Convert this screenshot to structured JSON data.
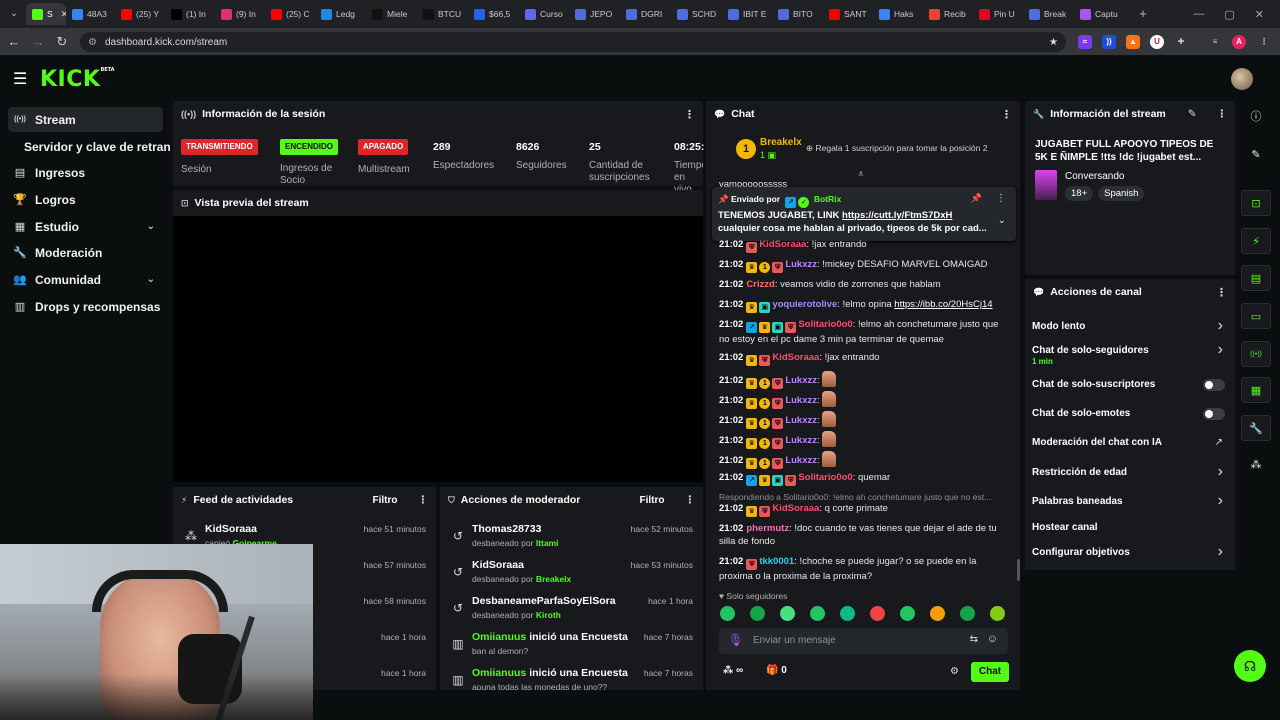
{
  "browser": {
    "tabs": [
      {
        "label": "S",
        "icon": "kick-favicon",
        "color": "#53fc18",
        "active": true
      },
      {
        "label": "48A3",
        "icon": "app-favicon",
        "color": "#3b82f6"
      },
      {
        "label": "(25) Y",
        "icon": "youtube-favicon",
        "color": "#ff0000"
      },
      {
        "label": "(1) In",
        "icon": "x-favicon",
        "color": "#000000"
      },
      {
        "label": "(9) In",
        "icon": "instagram-favicon",
        "color": "#e1306c"
      },
      {
        "label": "(25) C",
        "icon": "youtube-favicon",
        "color": "#ff0000"
      },
      {
        "label": "Ledg",
        "icon": "ledger-favicon",
        "color": "#1e88e5"
      },
      {
        "label": "Miele",
        "icon": "m-favicon",
        "color": "#111111"
      },
      {
        "label": "BTCU",
        "icon": "tv-favicon",
        "color": "#111111"
      },
      {
        "label": "$66,5",
        "icon": "x-favicon",
        "color": "#2563eb"
      },
      {
        "label": "Curso",
        "icon": "globe-favicon",
        "color": "#6366f1"
      },
      {
        "label": "JEPO",
        "icon": "sa-favicon",
        "color": "#4f6bdc"
      },
      {
        "label": "DGRI",
        "icon": "sa-favicon",
        "color": "#4f6bdc"
      },
      {
        "label": "SCHD",
        "icon": "sa-favicon",
        "color": "#4f6bdc"
      },
      {
        "label": "IBIT E",
        "icon": "sa-favicon",
        "color": "#4f6bdc"
      },
      {
        "label": "BITO",
        "icon": "sa-favicon",
        "color": "#4f6bdc"
      },
      {
        "label": "SANT",
        "icon": "santander-favicon",
        "color": "#ec0000"
      },
      {
        "label": "Haks",
        "icon": "doc-favicon",
        "color": "#3b82f6"
      },
      {
        "label": "Recib",
        "icon": "gmail-favicon",
        "color": "#ea4335"
      },
      {
        "label": "Pin U",
        "icon": "pinterest-favicon",
        "color": "#e60023"
      },
      {
        "label": "Break",
        "icon": "doc-favicon",
        "color": "#4f6bdc"
      },
      {
        "label": "Captu",
        "icon": "pen-favicon",
        "color": "#a855f7"
      }
    ],
    "new_tab": "+",
    "url": "dashboard.kick.com/stream",
    "profile_letter": "A"
  },
  "app": {
    "logo": "KICK",
    "logo_sup": "BETA"
  },
  "sidebar": {
    "items": [
      {
        "label": "Stream",
        "icon": "broadcast-icon"
      },
      {
        "label": "Servidor y clave de retransmisión",
        "icon": ""
      },
      {
        "label": "Ingresos",
        "icon": "chart-icon"
      },
      {
        "label": "Logros",
        "icon": "trophy-icon"
      },
      {
        "label": "Estudio",
        "icon": "grid-icon",
        "chevron": "⌄"
      },
      {
        "label": "Moderación",
        "icon": "wrench-icon"
      },
      {
        "label": "Comunidad",
        "icon": "users-icon",
        "chevron": "⌄"
      },
      {
        "label": "Drops y recompensas",
        "icon": "gift-icon"
      }
    ]
  },
  "session": {
    "title": "Información de la sesión",
    "badges": [
      {
        "text": "TRANSMITIENDO",
        "label": "Sesión",
        "bg": "#e0262b",
        "fg": "#ffffff"
      },
      {
        "text": "ENCENDIDO",
        "label": "Ingresos de Socio",
        "bg": "#53fc18",
        "fg": "#0b0e0f"
      },
      {
        "text": "APAGADO",
        "label": "Multistream",
        "bg": "#e0262b",
        "fg": "#ffffff"
      }
    ],
    "stats": [
      {
        "value": "289",
        "label": "Espectadores"
      },
      {
        "value": "8626",
        "label": "Seguidores"
      },
      {
        "value": "25",
        "label": "Cantidad de suscripciones"
      },
      {
        "value": "08:25:",
        "label": "Tiempo en vivo"
      }
    ]
  },
  "preview": {
    "title": "Vista previa del stream"
  },
  "activity": {
    "title": "Feed de actividades",
    "filter": "Filtro",
    "rows": [
      {
        "name": "KidSoraaa",
        "sub": "canjeó",
        "sub_bold": "Goipearme",
        "time": "hace 51 minutos"
      },
      {
        "name": "",
        "sub": "",
        "sub_bold": "",
        "time": "hace 57 minutos"
      },
      {
        "name": "",
        "sub": "",
        "sub_bold": "",
        "time": "hace 58 minutos"
      },
      {
        "name": "",
        "sub": "",
        "sub_bold": "",
        "time": "hace 1 hora"
      },
      {
        "name": "",
        "sub": "",
        "sub_bold": "",
        "time": "hace 1 hora"
      }
    ]
  },
  "modactions": {
    "title": "Acciones de moderador",
    "filter": "Filtro",
    "rows": [
      {
        "name": "Thomas28733",
        "rest": "",
        "sub": "desbaneado por",
        "by": "Ittami",
        "time": "hace 52 minutos",
        "icon": "undo-icon"
      },
      {
        "name": "KidSoraaa",
        "rest": "",
        "sub": "desbaneado por",
        "by": "Breakelx",
        "time": "hace 53 minutos",
        "icon": "undo-icon"
      },
      {
        "name": "DesbaneameParfaSoyElSora",
        "rest": "",
        "sub": "desbaneado por",
        "by": "Kiroth",
        "time": "hace 1 hora",
        "icon": "undo-icon"
      },
      {
        "name": "Omiianuus",
        "rest": "inició una Encuesta",
        "sub": "ban al demon?",
        "by": "",
        "time": "hace 7 horas",
        "icon": "poll-icon"
      },
      {
        "name": "Omiianuus",
        "rest": "inició una Encuesta",
        "sub": "apuna todas las monedas de uno??",
        "by": "",
        "time": "hace 7 horas",
        "icon": "poll-icon"
      }
    ]
  },
  "chat": {
    "title": "Chat",
    "top_gifter": {
      "name": "Breakelx",
      "count": "1"
    },
    "gift_prompt": "Regala 1 suscripción para tomar la posición 2",
    "partial": "vamooooosssss",
    "pinned": {
      "label": "Enviado por",
      "author": "BotRix",
      "line1": "TENEMOS JUGABET, LINK ",
      "link": "https://cutt.ly/FtmS7DxH",
      "line2": "cualquier cosa me hablan al privado, tipeos de 5k por cad..."
    },
    "messages": [
      {
        "time": "21:02",
        "user": "KidSoraaa",
        "color": "#ff4d6d",
        "text": ": !jax entrando",
        "badges": [
          "mod"
        ]
      },
      {
        "time": "21:02",
        "user": "Lukxzz",
        "color": "#c084fc",
        "text": ": !mickey DESAFIO MARVEL OMAIGAD",
        "badges": [
          "crown",
          "sub1",
          "mod"
        ]
      },
      {
        "time": "21:02",
        "user": "Crizzd",
        "color": "#ff6b6b",
        "text": ": veamos vidio de zorrones que hablam",
        "badges": []
      },
      {
        "time": "21:02",
        "user": "yoquierotolive",
        "color": "#a78bfa",
        "text": ": !elmo opina ",
        "link": "https://ibb.co/20HsCj14",
        "badges": [
          "crown",
          "gift"
        ]
      },
      {
        "time": "21:02",
        "user": "Solitario0o0",
        "color": "#ff4d6d",
        "text": ": !elmo ah conchetumare justo que no estoy en el pc dame 3 min pa terminar de quemae",
        "badges": [
          "vip",
          "crown",
          "gift",
          "mod"
        ]
      },
      {
        "time": "21:02",
        "user": "KidSoraaa",
        "color": "#ff4d6d",
        "text": ": !jax entrando",
        "badges": [
          "crown",
          "mod"
        ]
      },
      {
        "time": "21:02",
        "user": "Lukxzz",
        "color": "#c084fc",
        "text": ":",
        "emote": true,
        "badges": [
          "crown",
          "sub1",
          "mod"
        ]
      },
      {
        "time": "21:02",
        "user": "Lukxzz",
        "color": "#c084fc",
        "text": ":",
        "emote": true,
        "badges": [
          "crown",
          "sub1",
          "mod"
        ]
      },
      {
        "time": "21:02",
        "user": "Lukxzz",
        "color": "#c084fc",
        "text": ":",
        "emote": true,
        "badges": [
          "crown",
          "sub1",
          "mod"
        ]
      },
      {
        "time": "21:02",
        "user": "Lukxzz",
        "color": "#c084fc",
        "text": ":",
        "emote": true,
        "badges": [
          "crown",
          "sub1",
          "mod"
        ]
      },
      {
        "time": "21:02",
        "user": "Lukxzz",
        "color": "#c084fc",
        "text": ":",
        "emote": true,
        "badges": [
          "crown",
          "sub1",
          "mod"
        ]
      },
      {
        "time": "21:02",
        "user": "Solitario0o0",
        "color": "#ff4d6d",
        "text": ": quemar",
        "badges": [
          "vip",
          "crown",
          "gift",
          "mod"
        ]
      }
    ],
    "reply": {
      "context": "Respondiendo a Solitario0o0: !elmo ah conchetumare justo que no est...",
      "time": "21:02",
      "user": "KidSoraaa",
      "color": "#ff4d6d",
      "text": ": q corte primate"
    },
    "messages2": [
      {
        "time": "21:02",
        "user": "phermutz",
        "color": "#f472b6",
        "text": ": !doc cuando te vas tienes que dejar el ade de tu silla de fondo",
        "badges": []
      },
      {
        "time": "21:02",
        "user": "tkk0001",
        "color": "#22d3ee",
        "text": ": !choche se puede jugar? o se puede en la proxima o la proxima de la proxima?",
        "badges": [
          "mod"
        ]
      }
    ],
    "followers_only": "Solo seguidores",
    "input_placeholder": "Enviar un mensaje",
    "points": "∞",
    "gifts": "0",
    "send": "Chat"
  },
  "streaminfo": {
    "title": "Información del stream",
    "stream_title": "JUGABET FULL APOOYO TIPEOS DE 5K E ÑIMPLE !tts !dc !jugabet est...",
    "category": "Conversando",
    "tags": [
      "18+",
      "Spanish"
    ]
  },
  "channel": {
    "title": "Acciones de canal",
    "actions": [
      {
        "label": "Modo lento",
        "control": "chevron"
      },
      {
        "label": "Chat de solo-seguidores",
        "sub": "1 min",
        "control": "chevron"
      },
      {
        "label": "Chat de solo-suscriptores",
        "control": "toggle"
      },
      {
        "label": "Chat de solo-emotes",
        "control": "toggle"
      },
      {
        "label": "Moderación del chat con IA",
        "control": "external"
      },
      {
        "label": "Restricción de edad",
        "control": "chevron"
      },
      {
        "label": "Palabras baneadas",
        "control": "chevron"
      },
      {
        "label": "Hostear canal",
        "control": "none"
      },
      {
        "label": "Configurar objetivos",
        "control": "chevron"
      }
    ]
  },
  "rail": {
    "icons": [
      "info-icon",
      "edit-icon",
      "focus-icon",
      "lightning-icon",
      "file-icon",
      "chat-bubble-icon",
      "broadcast-icon",
      "layout-icon",
      "wrench-icon",
      "dots-icon"
    ]
  },
  "colors": {
    "accent": "#53fc18",
    "panel": "#17191c",
    "bg": "#0b0e0f",
    "danger": "#e0262b"
  }
}
